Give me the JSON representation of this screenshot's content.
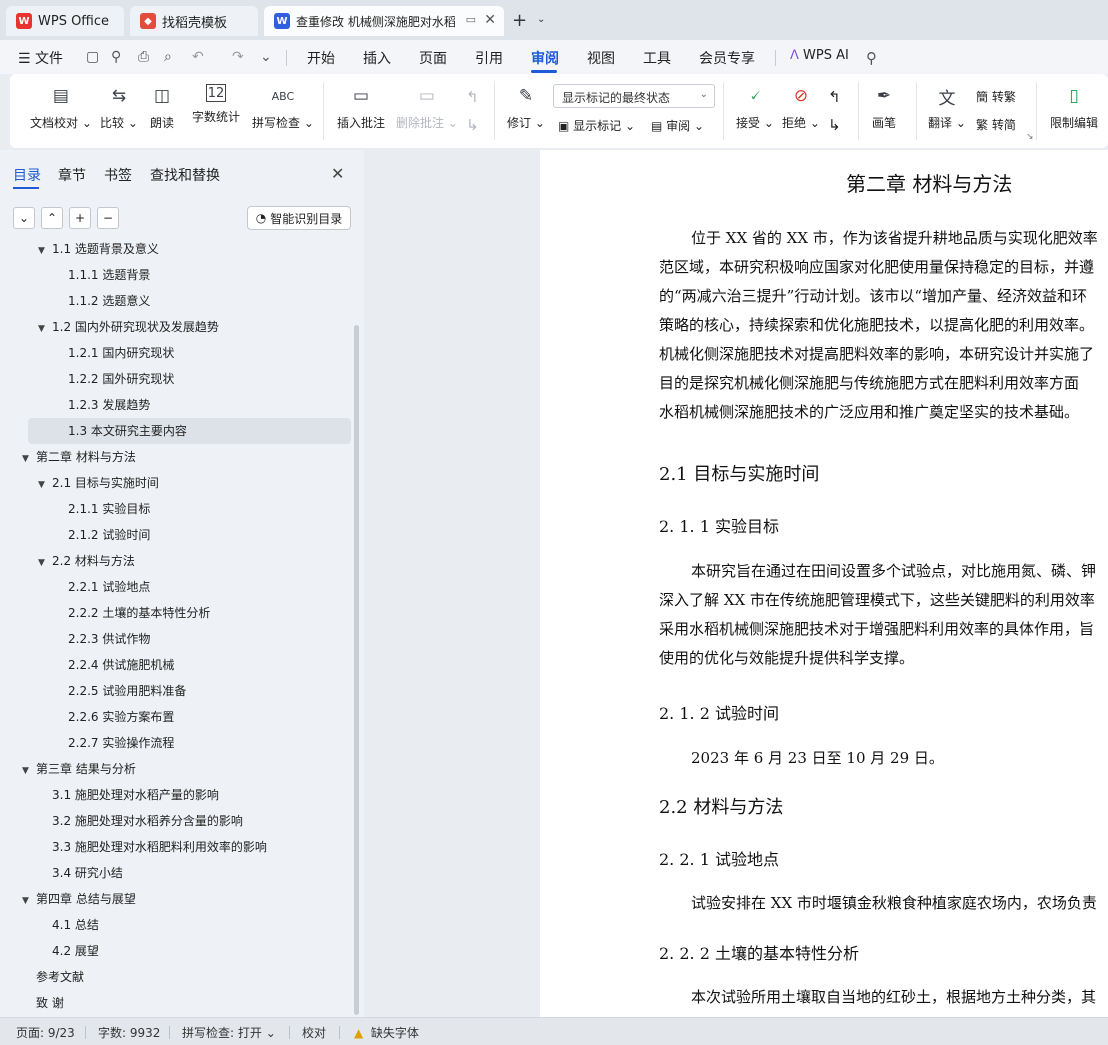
{
  "tabs": {
    "wps": "WPS Office",
    "template": "找稻壳模板",
    "doc": "查重修改 机械侧深施肥对水稻"
  },
  "menu": {
    "file": "文件",
    "items": [
      "开始",
      "插入",
      "页面",
      "引用",
      "审阅",
      "视图",
      "工具",
      "会员专享"
    ],
    "active": "审阅",
    "ai": "WPS AI"
  },
  "ribbon": {
    "doc_check": "文档校对",
    "compare": "比较",
    "read_aloud": "朗读",
    "word_count": "字数统计",
    "spell_check": "拼写检查",
    "insert_comment": "插入批注",
    "delete_comment": "删除批注",
    "revise": "修订",
    "display_select": "显示标记的最终状态",
    "show_markup": "显示标记",
    "review": "审阅",
    "accept": "接受",
    "reject": "拒绝",
    "pen": "画笔",
    "translate": "翻译",
    "to_traditional": "转繁",
    "to_simplified": "转简",
    "restrict_edit": "限制编辑"
  },
  "nav": {
    "tabs": [
      "目录",
      "章节",
      "书签",
      "查找和替换"
    ],
    "smart_toc": "智能识别目录",
    "toc": [
      {
        "text": "1.1 选题背景及意义",
        "level": 1,
        "arrow": true
      },
      {
        "text": "1.1.1 选题背景",
        "level": 2
      },
      {
        "text": "1.1.2 选题意义",
        "level": 2
      },
      {
        "text": "1.2  国内外研究现状及发展趋势",
        "level": 1,
        "arrow": true
      },
      {
        "text": "1.2.1  国内研究现状",
        "level": 2
      },
      {
        "text": "1.2.2  国外研究现状",
        "level": 2
      },
      {
        "text": "1.2.3  发展趋势",
        "level": 2
      },
      {
        "text": "1.3  本文研究主要内容",
        "level": 1,
        "selected": true
      },
      {
        "text": "第二章  材料与方法",
        "level": 0,
        "arrow": true
      },
      {
        "text": "2.1  目标与实施时间",
        "level": 1,
        "arrow": true
      },
      {
        "text": "2.1.1  实验目标",
        "level": 2
      },
      {
        "text": "2.1.2  试验时间",
        "level": 2
      },
      {
        "text": "2.2 材料与方法",
        "level": 1,
        "arrow": true
      },
      {
        "text": "2.2.1 试验地点",
        "level": 2
      },
      {
        "text": "2.2.2  土壤的基本特性分析",
        "level": 2
      },
      {
        "text": "2.2.3  供试作物",
        "level": 2
      },
      {
        "text": "2.2.4  供试施肥机械",
        "level": 2
      },
      {
        "text": "2.2.5  试验用肥料准备",
        "level": 2
      },
      {
        "text": "2.2.6  实验方案布置",
        "level": 2
      },
      {
        "text": "2.2.7  实验操作流程",
        "level": 2
      },
      {
        "text": "第三章  结果与分析",
        "level": 0,
        "arrow": true
      },
      {
        "text": "3.1  施肥处理对水稻产量的影响",
        "level": 1
      },
      {
        "text": "3.2  施肥处理对水稻养分含量的影响",
        "level": 1
      },
      {
        "text": "3.3  施肥处理对水稻肥料利用效率的影响",
        "level": 1
      },
      {
        "text": "3.4  研究小结",
        "level": 1
      },
      {
        "text": "第四章  总结与展望",
        "level": 0,
        "arrow": true
      },
      {
        "text": "4.1  总结",
        "level": 1
      },
      {
        "text": "4.2  展望",
        "level": 1
      },
      {
        "text": "参考文献",
        "level": 0
      },
      {
        "text": "致    谢",
        "level": 0
      }
    ]
  },
  "doc": {
    "chapter_title": "第二章  材料与方法",
    "para1": [
      "位于 XX 省的 XX 市，作为该省提升耕地品质与实现化肥效率",
      "范区域，本研究积极响应国家对化肥使用量保持稳定的目标，并遵",
      "的“两减六治三提升”行动计划。该市以“增加产量、经济效益和环",
      "策略的核心，持续探索和优化施肥技术，以提高化肥的利用效率。",
      "机械化侧深施肥技术对提高肥料效率的影响，本研究设计并实施了",
      "目的是探究机械化侧深施肥与传统施肥方式在肥料利用效率方面",
      "水稻机械侧深施肥技术的广泛应用和推广奠定坚实的技术基础。"
    ],
    "h_2_1": "2.1  目标与实施时间",
    "h_2_1_1": "2. 1. 1  实验目标",
    "para2": [
      "本研究旨在通过在田间设置多个试验点，对比施用氮、磷、钾",
      "深入了解 XX 市在传统施肥管理模式下，这些关键肥料的利用效率",
      "采用水稻机械侧深施肥技术对于增强肥料利用效率的具体作用，旨",
      "使用的优化与效能提升提供科学支撑。"
    ],
    "h_2_1_2": "2. 1. 2  试验时间",
    "para3": "2023 年 6 月 23 日至 10 月 29 日。",
    "h_2_2": "2.2 材料与方法",
    "h_2_2_1": "2. 2. 1 试验地点",
    "para4": "试验安排在 XX 市时堰镇金秋粮食种植家庭农场内，农场负责",
    "h_2_2_2": "2. 2. 2  土壤的基本特性分析",
    "para5": "本次试验所用土壤取自当地的红砂土，根据地方土种分类，其"
  },
  "status": {
    "page": "页面: 9/23",
    "words": "字数: 9932",
    "spell": "拼写检查: 打开",
    "proof": "校对",
    "missing_font": "缺失字体"
  }
}
